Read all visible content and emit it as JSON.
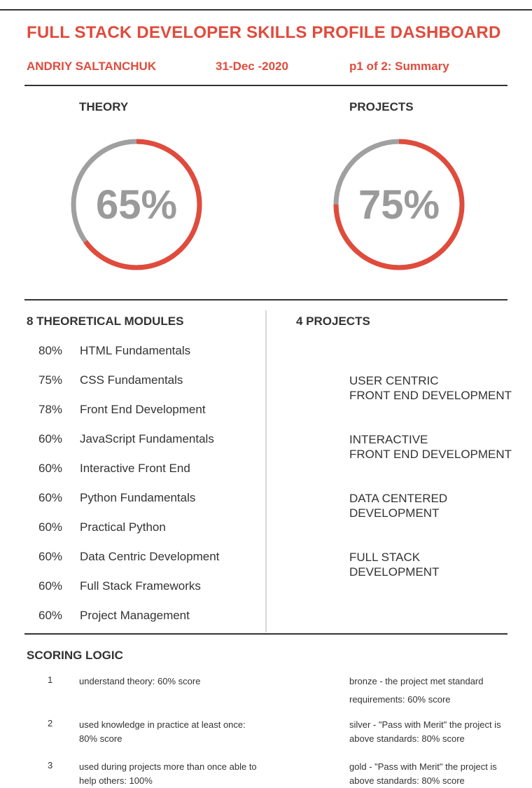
{
  "header": {
    "title": "FULL STACK DEVELOPER SKILLS PROFILE DASHBOARD",
    "author": "ANDRIY SALTANCHUK",
    "date": "31-Dec -2020",
    "page": "p1 of 2: Summary"
  },
  "gauges": {
    "theory": {
      "label": "THEORY",
      "value_text": "65%",
      "fraction": 0.65
    },
    "projects": {
      "label": "PROJECTS",
      "value_text": "75%",
      "fraction": 0.75
    }
  },
  "colors": {
    "accent": "#e04b3c",
    "ring_track": "#a0a0a0",
    "text": "#333333"
  },
  "modules": {
    "heading": "8 THEORETICAL MODULES",
    "items": [
      {
        "pct": "80%",
        "name": "HTML Fundamentals"
      },
      {
        "pct": "75%",
        "name": "CSS Fundamentals"
      },
      {
        "pct": "78%",
        "name": "Front End Development"
      },
      {
        "pct": "60%",
        "name": "JavaScript Fundamentals"
      },
      {
        "pct": "60%",
        "name": "Interactive Front End"
      },
      {
        "pct": "60%",
        "name": "Python Fundamentals"
      },
      {
        "pct": "60%",
        "name": "Practical Python"
      },
      {
        "pct": "60%",
        "name": "Data Centric Development"
      },
      {
        "pct": "60%",
        "name": "Full Stack Frameworks"
      },
      {
        "pct": "60%",
        "name": "Project Management"
      }
    ]
  },
  "projects": {
    "heading": "4 PROJECTS",
    "items": [
      "USER CENTRIC\nFRONT END DEVELOPMENT",
      "INTERACTIVE\nFRONT END DEVELOPMENT",
      "DATA CENTERED\nDEVELOPMENT",
      "FULL STACK\nDEVELOPMENT"
    ]
  },
  "scoring": {
    "heading": "SCORING LOGIC",
    "rows": [
      {
        "num": "1",
        "theory": "understand theory: 60% score",
        "award": "bronze - the project met standard requirements: 60% score"
      },
      {
        "num": "2",
        "theory": "used knowledge in practice at least once: 80% score",
        "award": "silver - \"Pass with Merit\" the project is above standards: 80% score"
      },
      {
        "num": "3",
        "theory": "used during projects more than once able to help others: 100%",
        "award": "gold - \"Pass with Merit\" the project is above standards: 80% score"
      }
    ]
  }
}
